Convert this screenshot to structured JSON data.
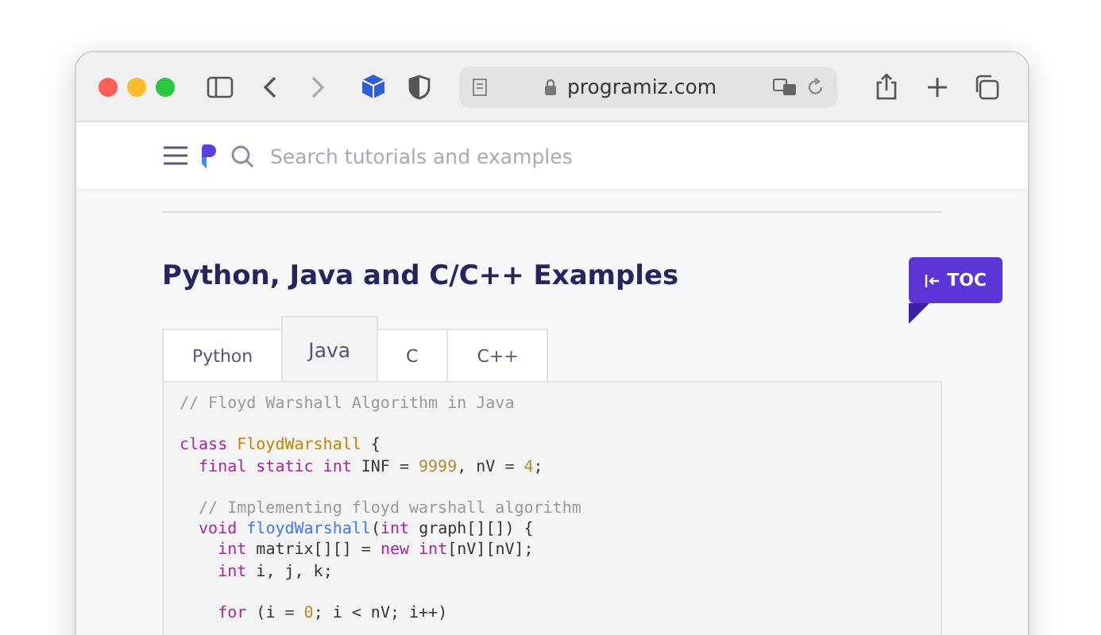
{
  "browser": {
    "address": "programiz.com"
  },
  "site_header": {
    "search": {
      "placeholder": "Search tutorials and examples"
    }
  },
  "heading": "Python, Java and C/C++ Examples",
  "toc_button": {
    "label": "TOC"
  },
  "tabs": [
    {
      "label": "Python",
      "selected": false
    },
    {
      "label": "Java",
      "selected": true
    },
    {
      "label": "C",
      "selected": false
    },
    {
      "label": "C++",
      "selected": false
    }
  ],
  "code_paragraphs": [
    [
      [
        {
          "kind": "comment",
          "text": "// Floyd Warshall Algorithm in Java"
        }
      ]
    ],
    [
      [
        {
          "kind": "keyword",
          "text": "class "
        },
        {
          "kind": "class",
          "text": "FloydWarshall"
        },
        {
          "kind": "plain",
          "text": " {"
        }
      ],
      [
        {
          "kind": "keyword",
          "text": "  final static int "
        },
        {
          "kind": "plain",
          "text": "INF = "
        },
        {
          "kind": "number",
          "text": "9999"
        },
        {
          "kind": "plain",
          "text": ", nV = "
        },
        {
          "kind": "number",
          "text": "4"
        },
        {
          "kind": "plain",
          "text": ";"
        }
      ]
    ],
    [
      [
        {
          "kind": "comment",
          "text": "  // Implementing floyd warshall algorithm"
        }
      ],
      [
        {
          "kind": "keyword",
          "text": "  void "
        },
        {
          "kind": "function",
          "text": "floydWarshall"
        },
        {
          "kind": "plain",
          "text": "("
        },
        {
          "kind": "keyword",
          "text": "int "
        },
        {
          "kind": "plain",
          "text": "graph[][]) {"
        }
      ],
      [
        {
          "kind": "keyword",
          "text": "    int "
        },
        {
          "kind": "plain",
          "text": "matrix[][] = "
        },
        {
          "kind": "keyword",
          "text": "new int"
        },
        {
          "kind": "plain",
          "text": "[nV][nV];"
        }
      ],
      [
        {
          "kind": "keyword",
          "text": "    int "
        },
        {
          "kind": "plain",
          "text": "i, j, k;"
        }
      ]
    ],
    [
      [
        {
          "kind": "keyword",
          "text": "    for "
        },
        {
          "kind": "plain",
          "text": "(i = "
        },
        {
          "kind": "number",
          "text": "0"
        },
        {
          "kind": "plain",
          "text": "; i < nV; i++)"
        }
      ]
    ]
  ]
}
